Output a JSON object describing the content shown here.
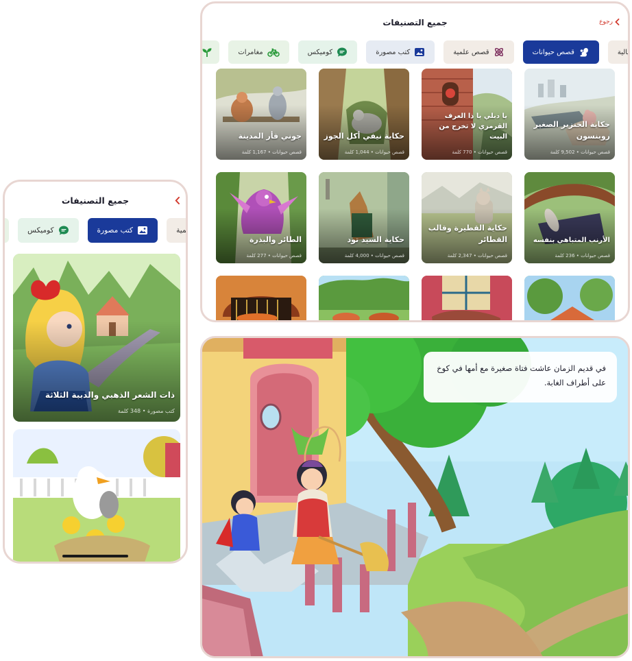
{
  "colors": {
    "accent": "#1a3a9a",
    "back": "#d23b2f",
    "frame_border": "#e8d6d2",
    "chip_science": "#f2ece6",
    "chip_picture": "#e6ebf3",
    "chip_comics": "#e5f3ea",
    "chip_adventures": "#e8f3e6",
    "chip_history": "#f2ece6"
  },
  "tablet": {
    "title": "جميع التصنيفات",
    "back_label": "رجوع",
    "chips": [
      {
        "label": "تاريخية خيالية",
        "icon": "",
        "active": false
      },
      {
        "label": "قصص حيوانات",
        "icon": "squirrel-icon",
        "active": true
      },
      {
        "label": "قصص علمية",
        "icon": "atom-icon",
        "active": false
      },
      {
        "label": "كتب مصورة",
        "icon": "picture-icon",
        "active": false
      },
      {
        "label": "كوميكس",
        "icon": "chat-bubble-icon",
        "active": false
      },
      {
        "label": "مغامرات",
        "icon": "bicycle-icon",
        "active": false
      },
      {
        "label": "",
        "icon": "sprout-icon",
        "active": false
      }
    ],
    "cards": [
      {
        "title": "حكاية الخنزير الصغير روبنسون",
        "meta": "قصص حيوانات • 9,502 كلمة"
      },
      {
        "title": "يا دبلي يا ذا العرف القرمزي لا تخرج من البيت",
        "meta": "قصص حيوانات • 770 كلمة"
      },
      {
        "title": "حكاية نيفي أكل الجوز",
        "meta": "قصص حيوانات • 1,044 كلمة"
      },
      {
        "title": "جوني فأر المدينة",
        "meta": "قصص حيوانات • 1,167 كلمة"
      },
      {
        "title": "الأرنب المتباهي بنفسه",
        "meta": "قصص حيوانات • 236 كلمة"
      },
      {
        "title": "حكاية القطيرة وقالب القطائر",
        "meta": "قصص حيوانات • 2,347 كلمة"
      },
      {
        "title": "حكاية السيد تود",
        "meta": "قصص حيوانات • 4,000 كلمة"
      },
      {
        "title": "الطائر والبذرة",
        "meta": "قصص حيوانات • 277 كلمة"
      },
      {
        "title": "",
        "meta": ""
      },
      {
        "title": "",
        "meta": ""
      },
      {
        "title": "",
        "meta": ""
      },
      {
        "title": "",
        "meta": ""
      }
    ]
  },
  "phone": {
    "title": "جميع التصنيفات",
    "chips": [
      {
        "label": "قصص علمية",
        "icon": "",
        "active": false
      },
      {
        "label": "كتب مصورة",
        "icon": "picture-icon",
        "active": true
      },
      {
        "label": "كوميكس",
        "icon": "chat-bubble-icon",
        "active": false
      }
    ],
    "cards": [
      {
        "title": "ذات الشعر الذهبي والدببة الثلاثة",
        "meta": "كتب مصورة • 348 كلمة"
      },
      {
        "title": "",
        "meta": ""
      }
    ]
  },
  "reader": {
    "text": "في قديم الزمان عاشت فتاة صغيرة مع أمها في كوخ على أطراف الغابة."
  }
}
